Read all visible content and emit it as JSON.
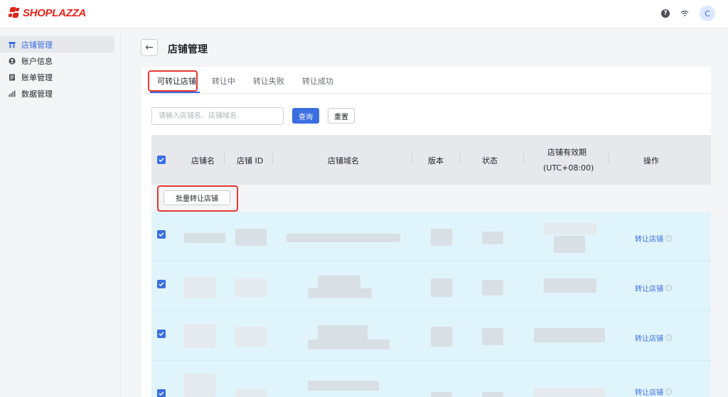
{
  "app": {
    "brand": "SHOPLAZZA",
    "avatar_initial": "C",
    "help_symbol": "?",
    "accent": "#3b6ee0",
    "brand_color": "#e2231a"
  },
  "topbar": {
    "icons": [
      "help-icon",
      "wifi-icon",
      "avatar"
    ]
  },
  "sidebar": {
    "items": [
      {
        "label": "店铺管理",
        "icon": "store-icon",
        "active": true
      },
      {
        "label": "账户信息",
        "icon": "user-icon",
        "active": false
      },
      {
        "label": "账单管理",
        "icon": "bill-icon",
        "active": false
      },
      {
        "label": "数据管理",
        "icon": "chart-icon",
        "active": false
      }
    ]
  },
  "header": {
    "back_symbol": "←",
    "title": "店铺管理"
  },
  "tabs": [
    {
      "label": "可转让店铺",
      "active": true
    },
    {
      "label": "转让中",
      "active": false
    },
    {
      "label": "转让失败",
      "active": false
    },
    {
      "label": "转让成功",
      "active": false
    }
  ],
  "search": {
    "placeholder": "请输入店铺名、店铺域名",
    "query_label": "查询",
    "reset_label": "重置"
  },
  "table": {
    "columns": [
      "店铺名",
      "店铺 ID",
      "店铺域名",
      "版本",
      "状态",
      "店铺有效期",
      "操作"
    ],
    "expiry_timezone": "(UTC+08:00)",
    "batch_label": "批量转让店铺",
    "rows": [
      {
        "action": "转让店铺",
        "checked": true
      },
      {
        "action": "转让店铺",
        "checked": true
      },
      {
        "action": "转让店铺",
        "checked": true
      },
      {
        "action": "转让店铺",
        "checked": true
      }
    ]
  }
}
